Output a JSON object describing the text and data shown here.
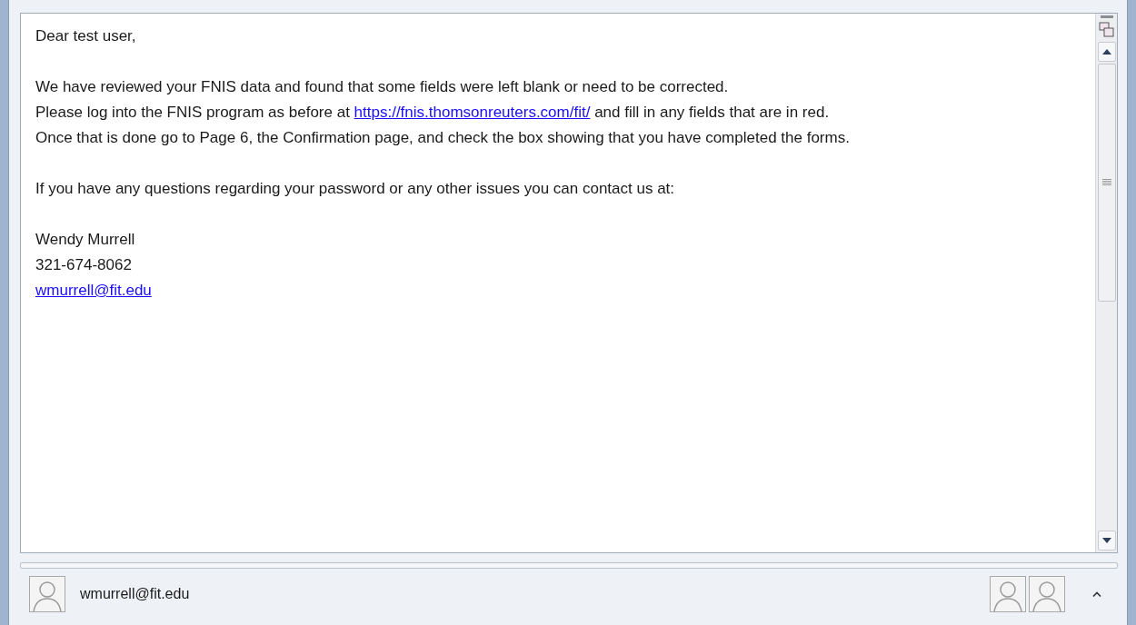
{
  "message": {
    "paragraphs": [
      [
        {
          "text": "Dear test user,"
        }
      ],
      [
        {
          "text": "We have reviewed your FNIS data and found that some fields were left blank or need to be corrected."
        },
        {
          "text": "Please log into the FNIS program as before at ",
          "link": "https://fnis.thomsonreuters.com/fit/",
          "after": " and fill in any fields that are in red."
        },
        {
          "text": "Once that is done go to Page 6, the Confirmation page, and check the box showing that you have completed the forms."
        }
      ],
      [
        {
          "text": "If you have any questions regarding your password or any other issues you can contact us at:"
        }
      ],
      [
        {
          "text": "Wendy Murrell"
        },
        {
          "text": "321-674-8062"
        },
        {
          "link": "wmurrell@fit.edu"
        }
      ]
    ]
  },
  "people_pane": {
    "sender": "wmurrell@fit.edu"
  }
}
